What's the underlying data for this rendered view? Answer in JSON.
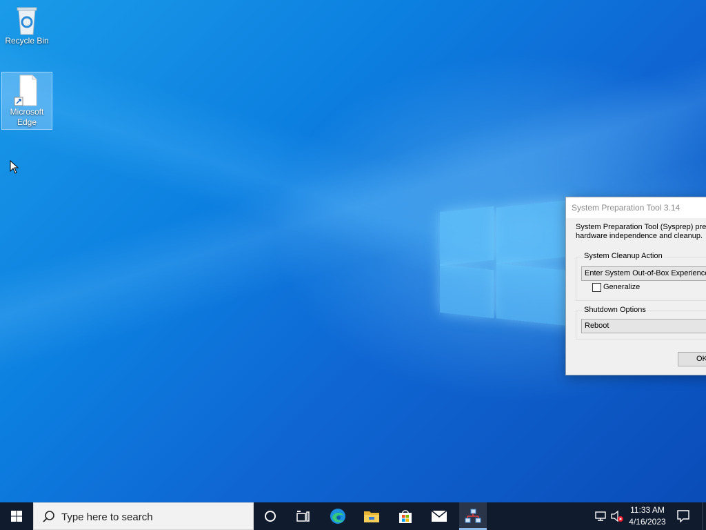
{
  "desktop": {
    "icons": [
      {
        "label": "Recycle Bin",
        "icon": "recycle-bin-icon"
      },
      {
        "label": "Microsoft Edge",
        "icon": "shortcut-file-icon"
      }
    ]
  },
  "dialog": {
    "title": "System Preparation Tool 3.14",
    "description_line1": "System Preparation Tool (Sysprep) prep",
    "description_line2": "hardware independence and cleanup.",
    "cleanup_group_label": "System Cleanup Action",
    "cleanup_action_value": "Enter System Out-of-Box Experience",
    "generalize_label": "Generalize",
    "generalize_checked": false,
    "shutdown_group_label": "Shutdown Options",
    "shutdown_value": "Reboot",
    "ok_label": "OK"
  },
  "taskbar": {
    "search_placeholder": "Type here to search",
    "apps": [
      "start-icon",
      "cortana-icon",
      "task-view-icon",
      "edge-icon",
      "file-explorer-icon",
      "store-icon",
      "mail-icon",
      "network-app-icon"
    ],
    "time": "11:33 AM",
    "date": "4/16/2023"
  },
  "colors": {
    "taskbar": "#101b2e",
    "desktop_accent": "#0c7fe0"
  }
}
